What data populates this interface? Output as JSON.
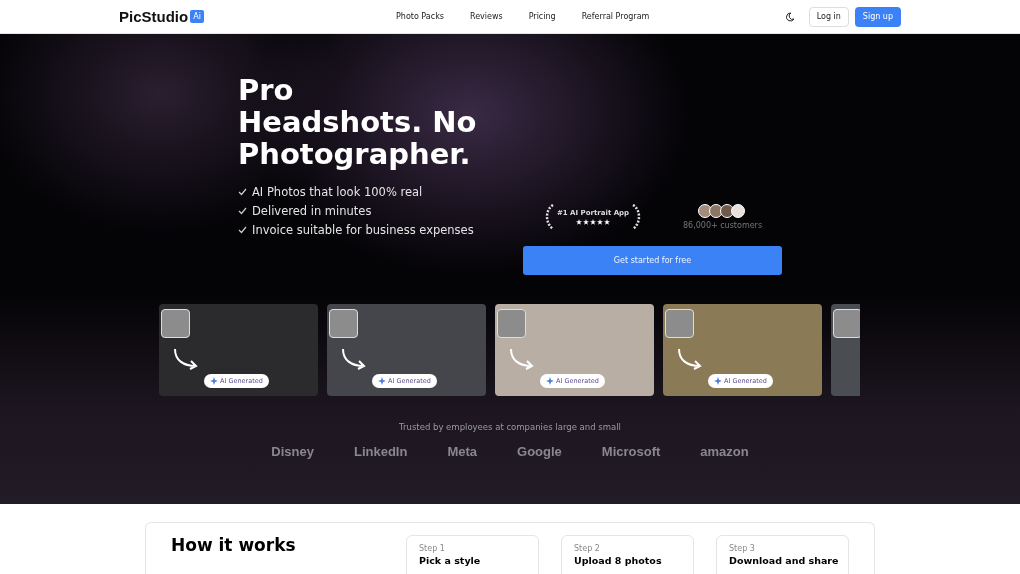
{
  "header": {
    "logo": "PicStudio",
    "logo_badge": "Ai",
    "nav": [
      "Photo Packs",
      "Reviews",
      "Pricing",
      "Referral Program"
    ],
    "login": "Log in",
    "signup": "Sign up"
  },
  "hero": {
    "title": "Pro Headshots. No Photographer.",
    "features": [
      "AI Photos that look 100% real",
      "Delivered in minutes",
      "Invoice suitable for business expenses"
    ],
    "award": {
      "label": "#1 AI Portrait App",
      "stars": 5
    },
    "customers": "86,000+ customers",
    "cta": "Get started for free"
  },
  "examples": [
    {
      "badge": "AI Generated"
    },
    {
      "badge": "AI Generated"
    },
    {
      "badge": "AI Generated"
    },
    {
      "badge": "AI Generated"
    }
  ],
  "trusted": {
    "caption": "Trusted by employees at companies large and small",
    "logos": [
      "Disney",
      "LinkedIn",
      "Meta",
      "Google",
      "Microsoft",
      "amazon"
    ]
  },
  "how": {
    "title": "How it works",
    "steps": [
      {
        "label": "Step 1",
        "title": "Pick a style"
      },
      {
        "label": "Step 2",
        "title": "Upload 8 photos"
      },
      {
        "label": "Step 3",
        "title": "Download and share"
      }
    ]
  }
}
